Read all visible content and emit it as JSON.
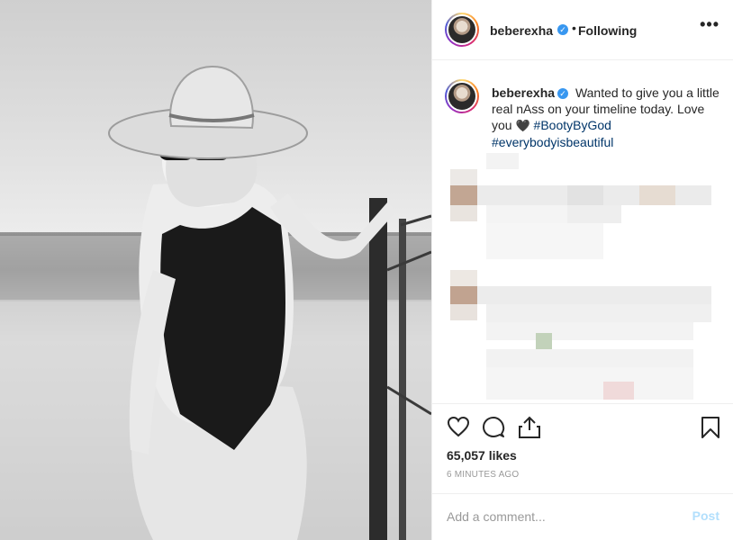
{
  "post": {
    "username": "beberexha",
    "verified_mark": "✓",
    "separator": "•",
    "follow_status": "Following",
    "more_options": "•••"
  },
  "caption": {
    "username": "beberexha",
    "text_before": "Wanted to give you a little real nAss on your timeline today. Love you",
    "heart_emoji": "🖤",
    "hashtags": [
      "#BootyByGod",
      "#everybodyisbeautiful"
    ]
  },
  "actions": {
    "icons": [
      "heart-icon",
      "comment-icon",
      "share-icon",
      "bookmark-icon"
    ],
    "likes": "65,057 likes",
    "timestamp": "6 MINUTES AGO"
  },
  "comment_box": {
    "placeholder": "Add a comment...",
    "post_label": "Post"
  },
  "colors": {
    "link": "#003569",
    "verified": "#3897f0",
    "post_disabled": "#b2dffc",
    "muted": "#999999"
  }
}
